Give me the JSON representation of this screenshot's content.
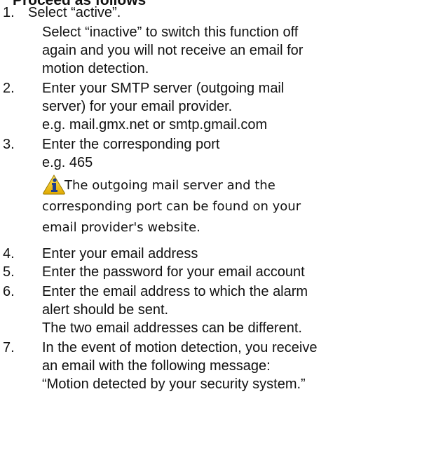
{
  "heading_fragment": "Proceed as follows",
  "steps": [
    {
      "number": "1.",
      "lines": [
        "Select “active”.",
        "Select “inactive” to switch this function off",
        "again and you will not receive an email for",
        "motion detection."
      ]
    },
    {
      "number": "2.",
      "lines": [
        "Enter your SMTP server (outgoing mail",
        "server) for your email provider.",
        "e.g. mail.gmx.net or smtp.gmail.com"
      ]
    },
    {
      "number": "3.",
      "lines": [
        "Enter the corresponding port",
        "e.g. 465"
      ],
      "note": {
        "icon": "info-warning-triangle-icon",
        "icon_color": "#f2c200",
        "lines": [
          "The outgoing mail server and the",
          "corresponding port can be found on your",
          "email provider's website."
        ]
      }
    },
    {
      "number": "4.",
      "lines": [
        "Enter your email address"
      ]
    },
    {
      "number": "5.",
      "lines": [
        "Enter the password for your email account"
      ]
    },
    {
      "number": "6.",
      "lines": [
        "Enter the email address to which the alarm",
        "alert should be sent.",
        "The two email addresses can be different."
      ]
    },
    {
      "number": "7.",
      "lines": [
        "In the event of motion detection, you receive",
        "an email with the following message:",
        "“Motion detected by your security system.”"
      ]
    }
  ]
}
